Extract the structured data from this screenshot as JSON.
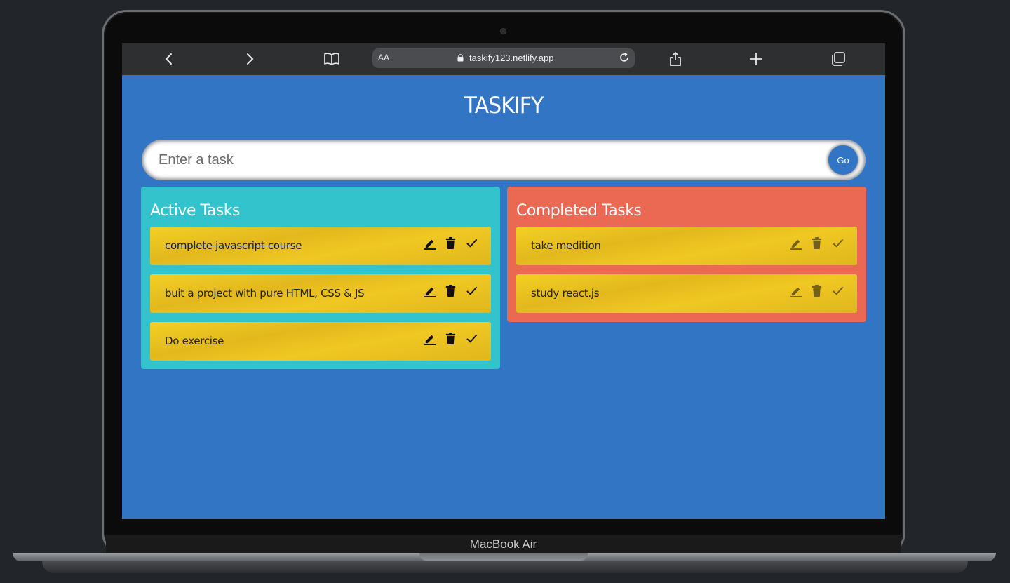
{
  "device": {
    "label": "MacBook Air"
  },
  "browser": {
    "aa_label": "AA",
    "url": "taskify123.netlify.app",
    "icons": [
      "back-icon",
      "forward-icon",
      "book-icon",
      "lock-icon",
      "reload-icon",
      "share-icon",
      "plus-icon",
      "tabs-icon"
    ]
  },
  "app": {
    "title": "TASKIFY",
    "input": {
      "placeholder": "Enter a task",
      "value": ""
    },
    "go_label": "Go",
    "active": {
      "heading": "Active Tasks",
      "tasks": [
        {
          "text": "complete javascript course",
          "strikethrough": true
        },
        {
          "text": "buit a project with pure HTML, CSS & JS",
          "strikethrough": false
        },
        {
          "text": "Do exercise",
          "strikethrough": false
        }
      ]
    },
    "completed": {
      "heading": "Completed Tasks",
      "tasks": [
        {
          "text": "take medition"
        },
        {
          "text": "study react.js"
        }
      ]
    },
    "colors": {
      "background": "#3175c4",
      "active_panel": "#32c3cd",
      "completed_panel": "#eb6852",
      "card": "#f0c823"
    }
  }
}
